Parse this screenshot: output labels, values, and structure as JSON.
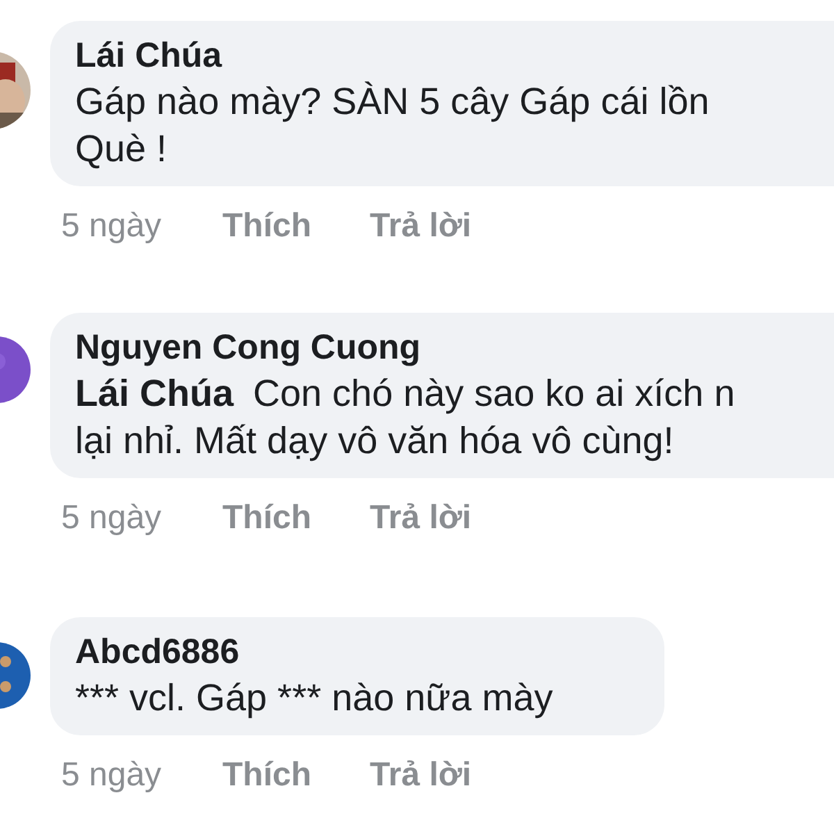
{
  "comments": [
    {
      "author": "Lái Chúa",
      "body_lines": [
        "Gáp nào mày? SÀN 5 cây Gáp cái lồn",
        "Què !"
      ],
      "time": "5 ngày",
      "like": "Thích",
      "reply": "Trả lời"
    },
    {
      "author": "Nguyen Cong Cuong",
      "mention": "Lái Chúa",
      "body_lines": [
        "Con chó này sao ko ai xích n",
        "lại nhỉ. Mất dạy vô văn hóa vô cùng!"
      ],
      "time": "5 ngày",
      "like": "Thích",
      "reply": "Trả lời"
    },
    {
      "author": "Abcd6886",
      "body_lines": [
        "*** vcl. Gáp *** nào nữa mày"
      ],
      "time": "5 ngày",
      "like": "Thích",
      "reply": "Trả lời"
    }
  ]
}
